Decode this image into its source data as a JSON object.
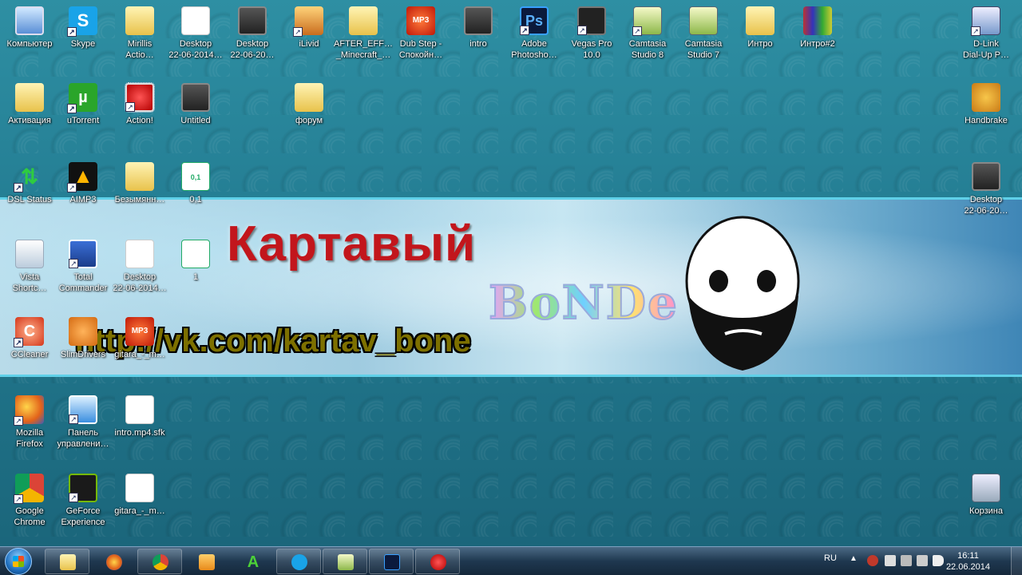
{
  "banner": {
    "title": "Картавый",
    "script": "BoNDe",
    "url": "http://vk.com/kartav_bone"
  },
  "icons": {
    "computer": "Компьютер",
    "skype": "Skype",
    "mirillis": "Mirillis\nActio…",
    "desktop1": "Desktop\n22-06-2014…",
    "desktop2": "Desktop\n22-06-20…",
    "ilivid": "iLivid",
    "aftereff": "AFTER_EFF…\n_Minecraft_…",
    "dubstep": "Dub Step -\nСпокойн…",
    "intro": "intro",
    "photoshop": "Adobe\nPhotosho…",
    "vegas": "Vegas Pro\n10.0",
    "camtasia8": "Camtasia\nStudio 8",
    "camtasia7": "Camtasia\nStudio 7",
    "intro_folder": "Интро",
    "intro2": "Интро#2",
    "dlink": "D-Link\nDial-Up P…",
    "activation": "Активация",
    "utorrent": "uTorrent",
    "action": "Action!",
    "untitled": "Untitled",
    "forum": "форум",
    "handbrake": "Handbrake",
    "dsl": "DSL Status",
    "aimp": "AIMP3",
    "unnamed": "Безымянн…",
    "oil": "0,1",
    "desktop_right": "Desktop\n22-06-20…",
    "vista": "Vista\nShortc…",
    "totalcmd": "Total\nCommander",
    "desktop3": "Desktop\n22-06-2014…",
    "one": "1",
    "ccleaner": "CCleaner",
    "slimdrivers": "SlimDrivers",
    "gitara1": "gitara_-_m…",
    "firefox": "Mozilla\nFirefox",
    "cpanel": "Панель\nуправлени…",
    "intro_sfk": "intro.mp4.sfk",
    "chrome": "Google\nChrome",
    "geforce": "GeForce\nExperience",
    "gitara2": "gitara_-_m…",
    "recycle": "Корзина"
  },
  "glyph_text": {
    "skype": "S",
    "mp3": "MP3",
    "ps": "Ps",
    "utorrent": "µ",
    "dsl": "⇅",
    "aimp": "▲",
    "oil": "0,1",
    "ccleaner": "C",
    "shortcut": "↗"
  },
  "taskbar": {
    "lang": "RU",
    "tray_arrow": "▲",
    "time": "16:11",
    "date": "22.06.2014"
  },
  "colors": {
    "banner_title": "#c2161c",
    "taskbar": "#1f3850",
    "accent": "#5fd0e8"
  }
}
